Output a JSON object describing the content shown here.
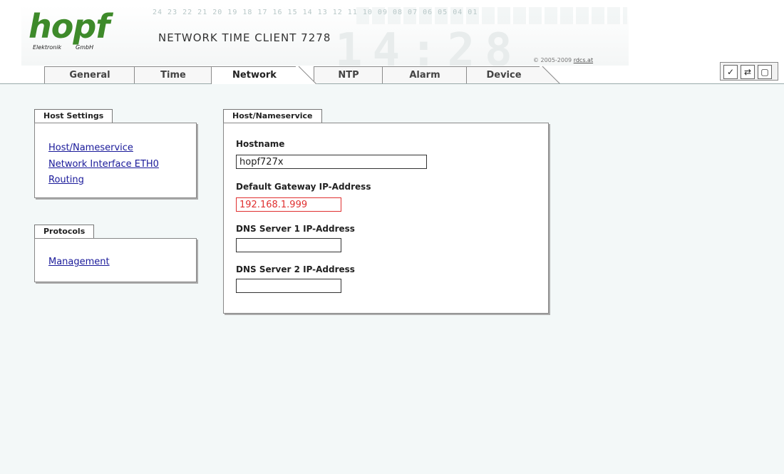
{
  "brand": {
    "logo_text": "hopf",
    "logo_sub_left": "Elektronik",
    "logo_sub_right": "GmbH",
    "product_title": "NETWORK TIME CLIENT 7278",
    "copyright_prefix": "© 2005-2009",
    "copyright_link": "rdcs.at",
    "banner_digits": "24 23 22 21 20 19 18 17 16 15 14 13 12 11 10 09 08 07 06 05 04 01",
    "banner_clock": "14:28",
    "color_green": "#3e8a2a"
  },
  "tabs": [
    {
      "label": "General",
      "active": false
    },
    {
      "label": "Time",
      "active": false
    },
    {
      "label": "Network",
      "active": true
    },
    {
      "label": "NTP",
      "active": false
    },
    {
      "label": "Alarm",
      "active": false
    },
    {
      "label": "Device",
      "active": false
    }
  ],
  "toolbar": {
    "apply_icon": "check-icon",
    "reload_icon": "refresh-icon",
    "save_icon": "save-icon",
    "apply_glyph": "✓",
    "reload_glyph": "⇄",
    "save_glyph": "▢"
  },
  "sidebar": {
    "host_settings": {
      "title": "Host Settings",
      "links": [
        "Host/Nameservice",
        "Network Interface ETH0",
        "Routing"
      ]
    },
    "protocols": {
      "title": "Protocols",
      "links": [
        "Management"
      ]
    }
  },
  "form": {
    "title": "Host/Nameservice",
    "hostname": {
      "label": "Hostname",
      "value": "hopf727x"
    },
    "gateway": {
      "label": "Default Gateway IP-Address",
      "value": "192.168.1.999",
      "status": "error"
    },
    "dns1": {
      "label": "DNS Server 1 IP-Address",
      "value": ""
    },
    "dns2": {
      "label": "DNS Server 2 IP-Address",
      "value": ""
    }
  },
  "colors": {
    "content_bg": "#f3f8f8",
    "link": "#1a1a9a",
    "error": "#e03030"
  }
}
